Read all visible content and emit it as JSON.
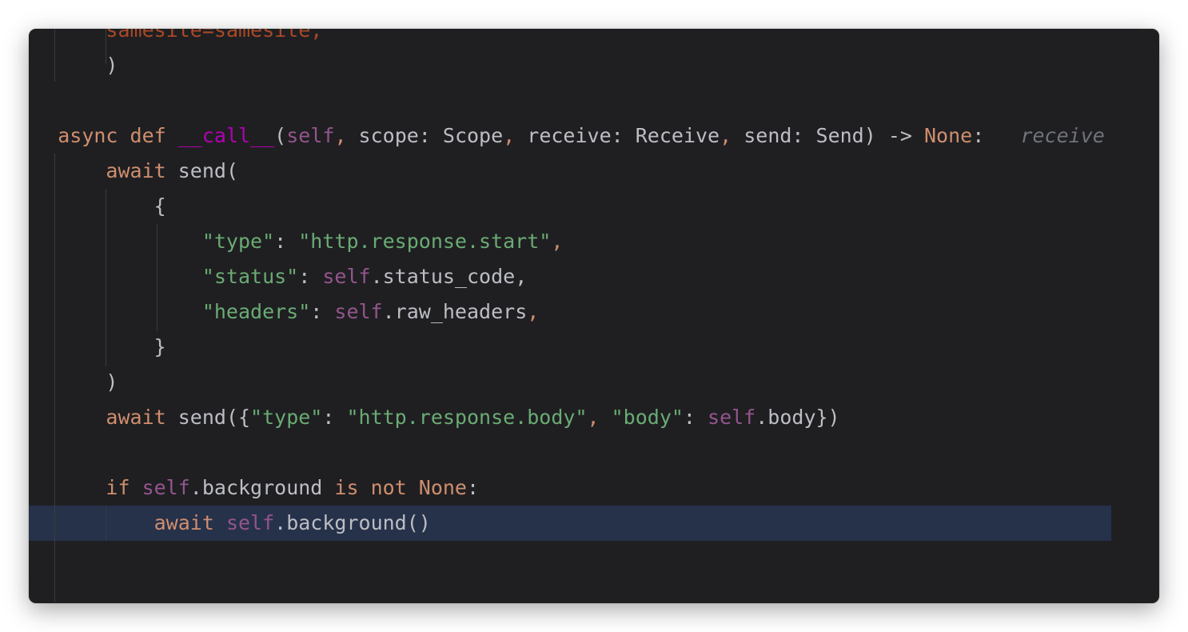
{
  "lines": [
    [
      {
        "t": "        ",
        "c": ""
      },
      {
        "t": "samesite",
        "c": "kwarg"
      },
      {
        "t": "=samesite,",
        "c": "kwarg"
      }
    ],
    [
      {
        "t": "        )",
        "c": ""
      }
    ],
    [
      {
        "t": "",
        "c": ""
      }
    ],
    [
      {
        "t": "    ",
        "c": ""
      },
      {
        "t": "async def ",
        "c": "kw"
      },
      {
        "t": "__call__",
        "c": "dunder"
      },
      {
        "t": "(",
        "c": ""
      },
      {
        "t": "self",
        "c": "self"
      },
      {
        "t": ", ",
        "c": "kw"
      },
      {
        "t": "scope: Scope",
        "c": ""
      },
      {
        "t": ", ",
        "c": "kw"
      },
      {
        "t": "receive: Receive",
        "c": ""
      },
      {
        "t": ", ",
        "c": "kw"
      },
      {
        "t": "send: Send) -> ",
        "c": ""
      },
      {
        "t": "None",
        "c": "kw"
      },
      {
        "t": ":   ",
        "c": ""
      },
      {
        "t": "receive",
        "c": "hint"
      }
    ],
    [
      {
        "t": "        ",
        "c": ""
      },
      {
        "t": "await ",
        "c": "kw"
      },
      {
        "t": "send(",
        "c": ""
      }
    ],
    [
      {
        "t": "            {",
        "c": ""
      }
    ],
    [
      {
        "t": "                ",
        "c": ""
      },
      {
        "t": "\"type\"",
        "c": "str"
      },
      {
        "t": ": ",
        "c": ""
      },
      {
        "t": "\"http.response.start\"",
        "c": "str"
      },
      {
        "t": ",",
        "c": "kw"
      }
    ],
    [
      {
        "t": "                ",
        "c": ""
      },
      {
        "t": "\"status\"",
        "c": "str"
      },
      {
        "t": ": ",
        "c": ""
      },
      {
        "t": "self",
        "c": "self"
      },
      {
        "t": ".status_code,",
        "c": ""
      }
    ],
    [
      {
        "t": "                ",
        "c": ""
      },
      {
        "t": "\"headers\"",
        "c": "str"
      },
      {
        "t": ": ",
        "c": ""
      },
      {
        "t": "self",
        "c": "self"
      },
      {
        "t": ".raw_headers",
        "c": ""
      },
      {
        "t": ",",
        "c": "kw"
      }
    ],
    [
      {
        "t": "            }",
        "c": ""
      }
    ],
    [
      {
        "t": "        )",
        "c": ""
      }
    ],
    [
      {
        "t": "        ",
        "c": ""
      },
      {
        "t": "await ",
        "c": "kw"
      },
      {
        "t": "send({",
        "c": ""
      },
      {
        "t": "\"type\"",
        "c": "str"
      },
      {
        "t": ": ",
        "c": ""
      },
      {
        "t": "\"http.response.body\"",
        "c": "str"
      },
      {
        "t": ", ",
        "c": "kw"
      },
      {
        "t": "\"body\"",
        "c": "str"
      },
      {
        "t": ": ",
        "c": ""
      },
      {
        "t": "self",
        "c": "self"
      },
      {
        "t": ".body})",
        "c": ""
      }
    ],
    [
      {
        "t": "",
        "c": ""
      }
    ],
    [
      {
        "t": "        ",
        "c": ""
      },
      {
        "t": "if ",
        "c": "kw"
      },
      {
        "t": "self",
        "c": "self"
      },
      {
        "t": ".background ",
        "c": ""
      },
      {
        "t": "is not ",
        "c": "kw"
      },
      {
        "t": "None",
        "c": "kw"
      },
      {
        "t": ":",
        "c": ""
      }
    ],
    [
      {
        "t": "            ",
        "c": ""
      },
      {
        "t": "await ",
        "c": "kw"
      },
      {
        "t": "self",
        "c": "self"
      },
      {
        "t": ".background()",
        "c": ""
      }
    ],
    [
      {
        "t": "",
        "c": ""
      }
    ]
  ],
  "current_line": 14
}
